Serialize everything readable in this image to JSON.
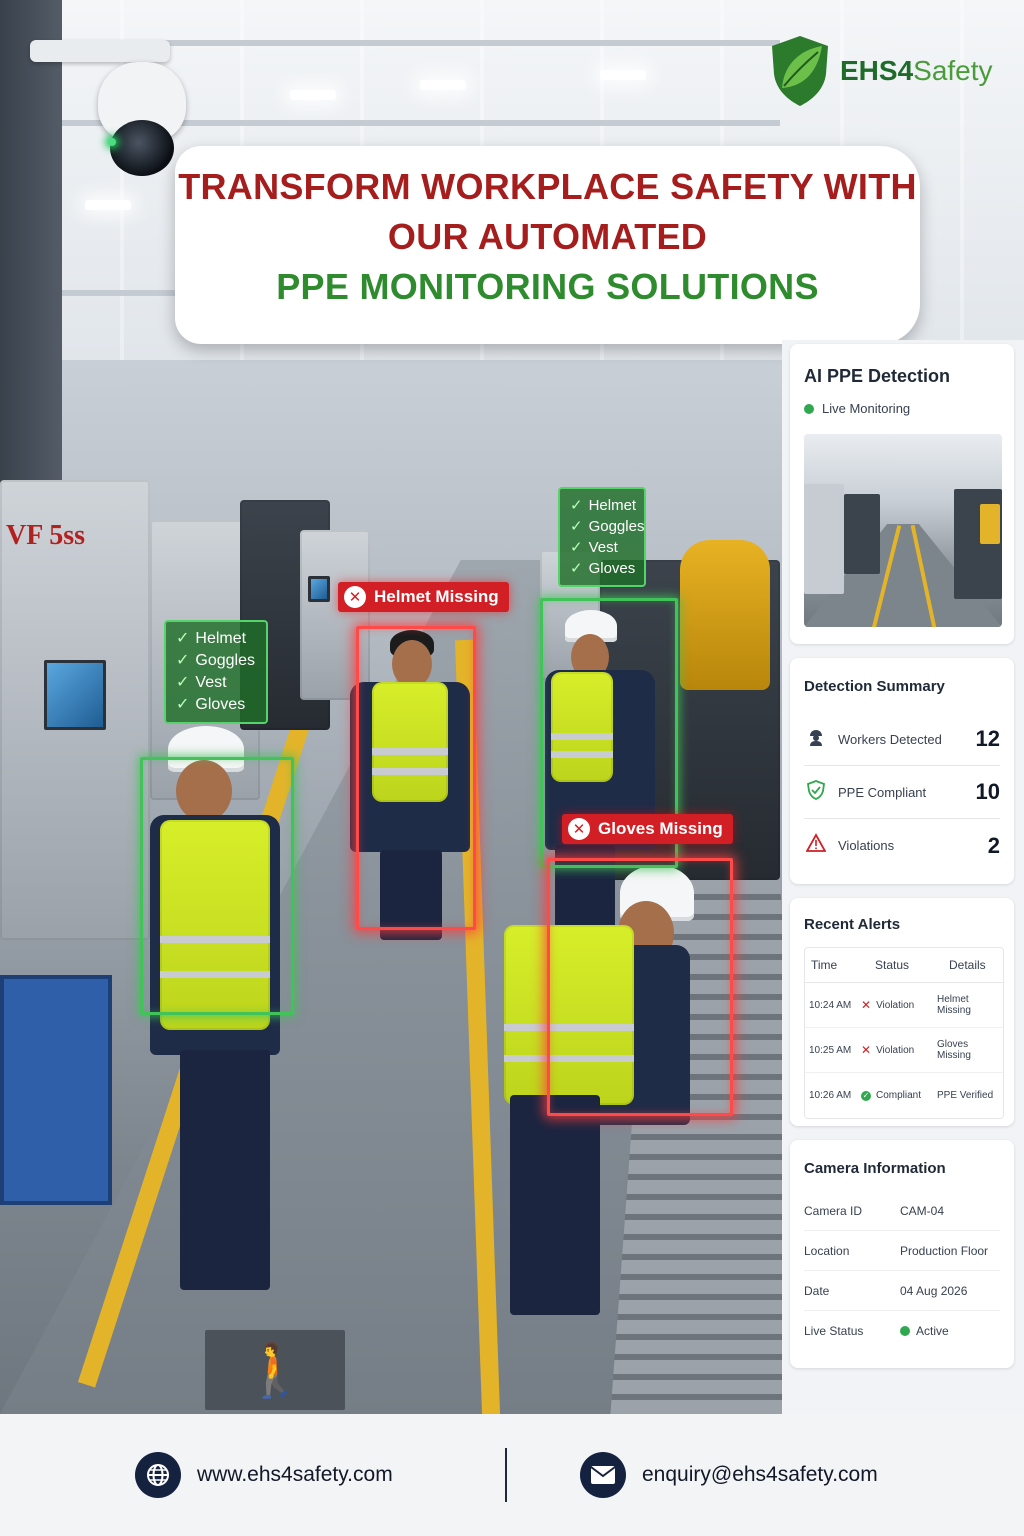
{
  "brand": {
    "name_bold": "EHS",
    "name_num": "4",
    "name_rest": "Safety"
  },
  "headline": {
    "line1": "TRANSFORM WORKPLACE SAFETY WITH",
    "line2": "OUR AUTOMATED",
    "line3": "PPE MONITORING SOLUTIONS"
  },
  "scene": {
    "machine_brand": "VF 5ss",
    "ppe_items": [
      "Helmet",
      "Goggles",
      "Vest",
      "Gloves"
    ],
    "alert_helmet": "Helmet Missing",
    "alert_gloves": "Gloves Missing",
    "colors": {
      "ok": "#41c35a",
      "violation": "#d11f25"
    }
  },
  "panel": {
    "detection": {
      "title": "AI PPE Detection",
      "status": "Live Monitoring"
    },
    "summary": {
      "title": "Detection Summary",
      "rows": [
        {
          "icon": "worker-icon",
          "label": "Workers Detected",
          "value": "12"
        },
        {
          "icon": "shield-check-icon",
          "label": "PPE Compliant",
          "value": "10"
        },
        {
          "icon": "warning-icon",
          "label": "Violations",
          "value": "2"
        }
      ]
    },
    "alerts": {
      "title": "Recent Alerts",
      "headers": [
        "Time",
        "Status",
        "Details"
      ],
      "rows": [
        {
          "time": "10:24 AM",
          "status": "Violation",
          "details": "Helmet Missing",
          "kind": "violation"
        },
        {
          "time": "10:25 AM",
          "status": "Violation",
          "details": "Gloves Missing",
          "kind": "violation"
        },
        {
          "time": "10:26 AM",
          "status": "Compliant",
          "details": "PPE Verified",
          "kind": "compliant"
        }
      ]
    },
    "camera": {
      "title": "Camera Information",
      "rows": [
        {
          "key": "Camera ID",
          "value": "CAM-04"
        },
        {
          "key": "Location",
          "value": "Production Floor"
        },
        {
          "key": "Date",
          "value": "04 Aug 2026"
        },
        {
          "key": "Live Status",
          "value": "Active"
        }
      ]
    }
  },
  "footer": {
    "website": "www.ehs4safety.com",
    "email": "enquiry@ehs4safety.com"
  }
}
